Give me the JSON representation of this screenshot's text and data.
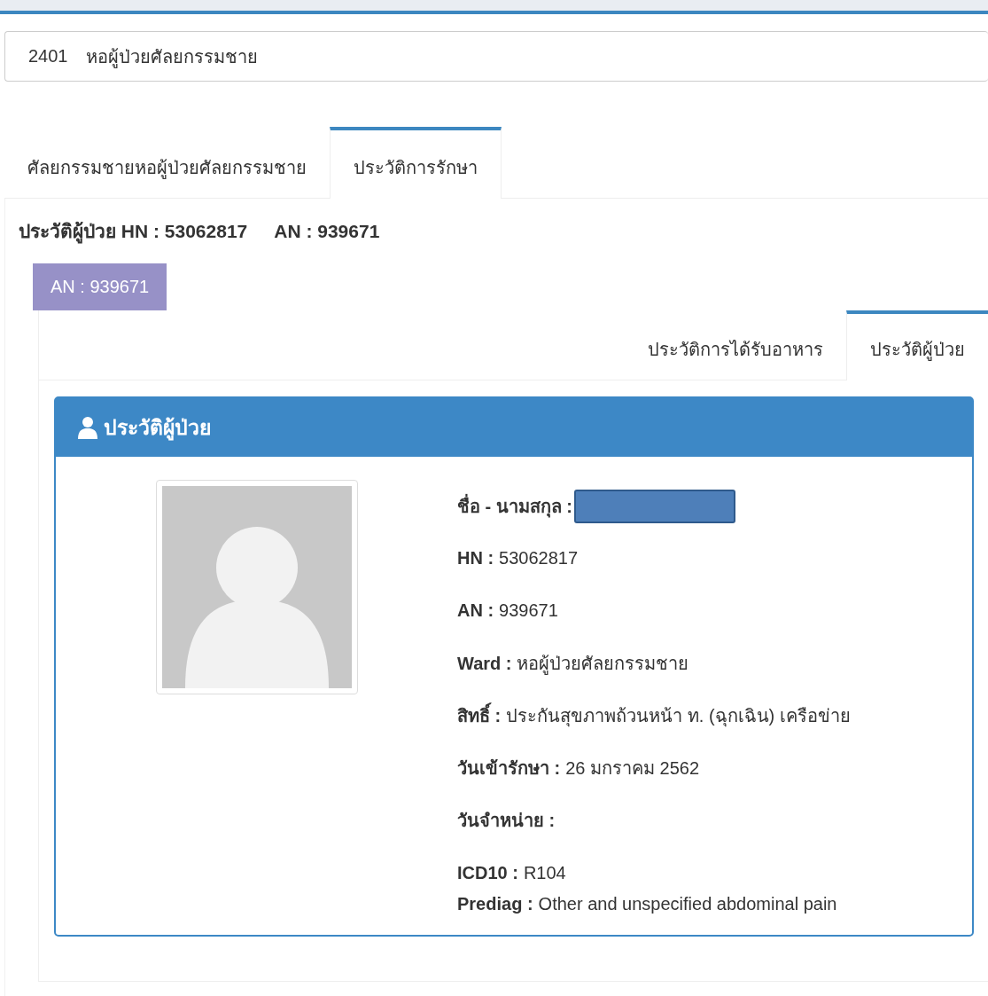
{
  "ward_select": {
    "code": "2401",
    "name": "หอผู้ป่วยศัลยกรรมชาย"
  },
  "tabs": [
    {
      "label": "ศัลยกรรมชายหอผู้ป่วยศัลยกรรมชาย",
      "selected": false
    },
    {
      "label": "ประวัติการรักษา",
      "selected": true
    }
  ],
  "heading": {
    "hn": "ประวัติผู้ป่วย HN : 53062817",
    "an": "AN : 939671"
  },
  "an_button": {
    "label": "AN : 939671"
  },
  "inner_tabs": [
    {
      "label": "ประวัติการได้รับอาหาร",
      "selected": false
    },
    {
      "label": "ประวัติผู้ป่วย",
      "selected": true
    }
  ],
  "panel": {
    "title": "ประวัติผู้ป่วย",
    "fields": [
      {
        "kind": "redacted",
        "label": "ชื่อ - นามสกุล :"
      },
      {
        "kind": "text",
        "label": "HN :",
        "value": "53062817"
      },
      {
        "kind": "text",
        "label": "AN :",
        "value": "939671"
      },
      {
        "kind": "text",
        "label": "Ward :",
        "value": "หอผู้ป่วยศัลยกรรมชาย"
      },
      {
        "kind": "text",
        "label": "สิทธิ์ :",
        "value": "ประกันสุขภาพถ้วนหน้า ท. (ฉุกเฉิน) เครือข่าย"
      },
      {
        "kind": "text",
        "label": "วันเข้ารักษา :",
        "value": "26 มกราคม 2562"
      },
      {
        "kind": "text",
        "label": "วันจำหน่าย :"
      },
      {
        "kind": "text",
        "label": "ICD10 :",
        "value": "R104"
      },
      {
        "kind": "text",
        "label": "Prediag :",
        "value": "Other and unspecified abdominal pain"
      }
    ]
  }
}
